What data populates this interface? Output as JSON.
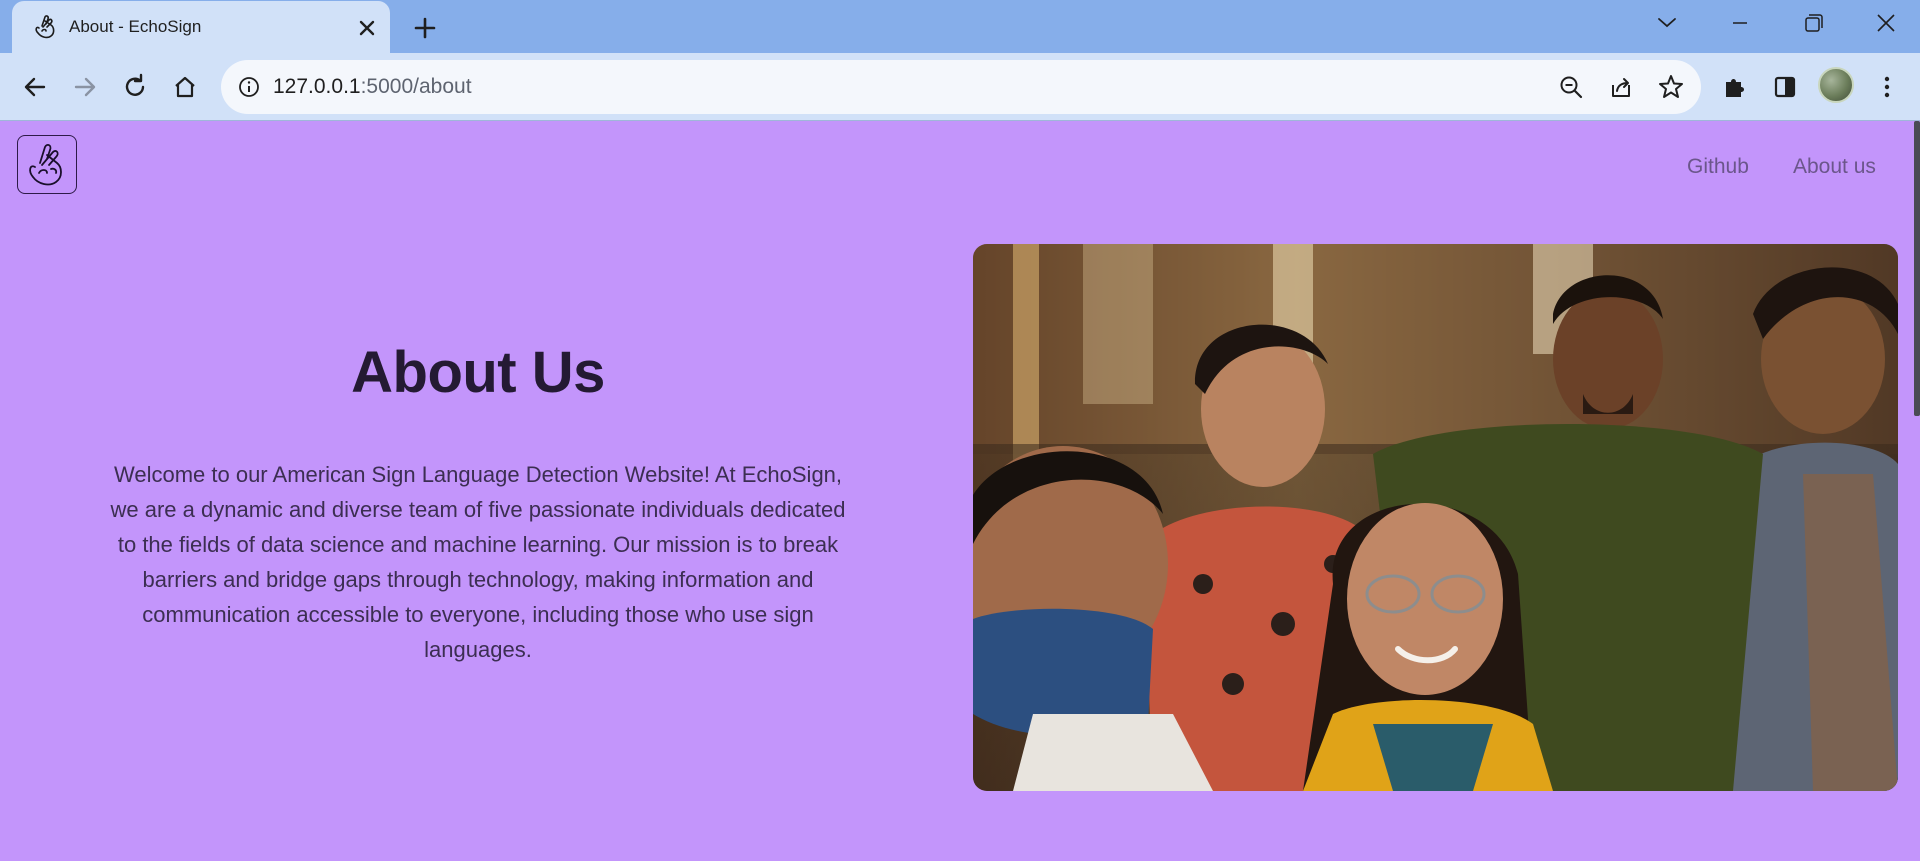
{
  "browser": {
    "tab_title": "About - EchoSign",
    "url_host": "127.0.0.1",
    "url_path": ":5000/about"
  },
  "nav": {
    "github": "Github",
    "about": "About us"
  },
  "about": {
    "heading": "About Us",
    "description": "Welcome to our American Sign Language Detection Website! At EchoSign, we are a dynamic and diverse team of five passionate individuals dedicated to the fields of data science and machine learning. Our mission is to break barriers and bridge gaps through technology, making information and communication accessible to everyone, including those who use sign languages."
  },
  "colors": {
    "page_background": "#c395fb",
    "tab_strip": "#86aeea",
    "toolbar": "#d1e1f8"
  },
  "icons": [
    "crossed-fingers-icon",
    "close-icon",
    "plus-icon",
    "chevron-down-icon",
    "minimize-icon",
    "restore-icon",
    "back-arrow-icon",
    "forward-arrow-icon",
    "reload-icon",
    "home-icon",
    "info-icon",
    "zoom-out-icon",
    "share-icon",
    "star-icon",
    "puzzle-icon",
    "side-panel-icon",
    "kebab-menu-icon"
  ]
}
